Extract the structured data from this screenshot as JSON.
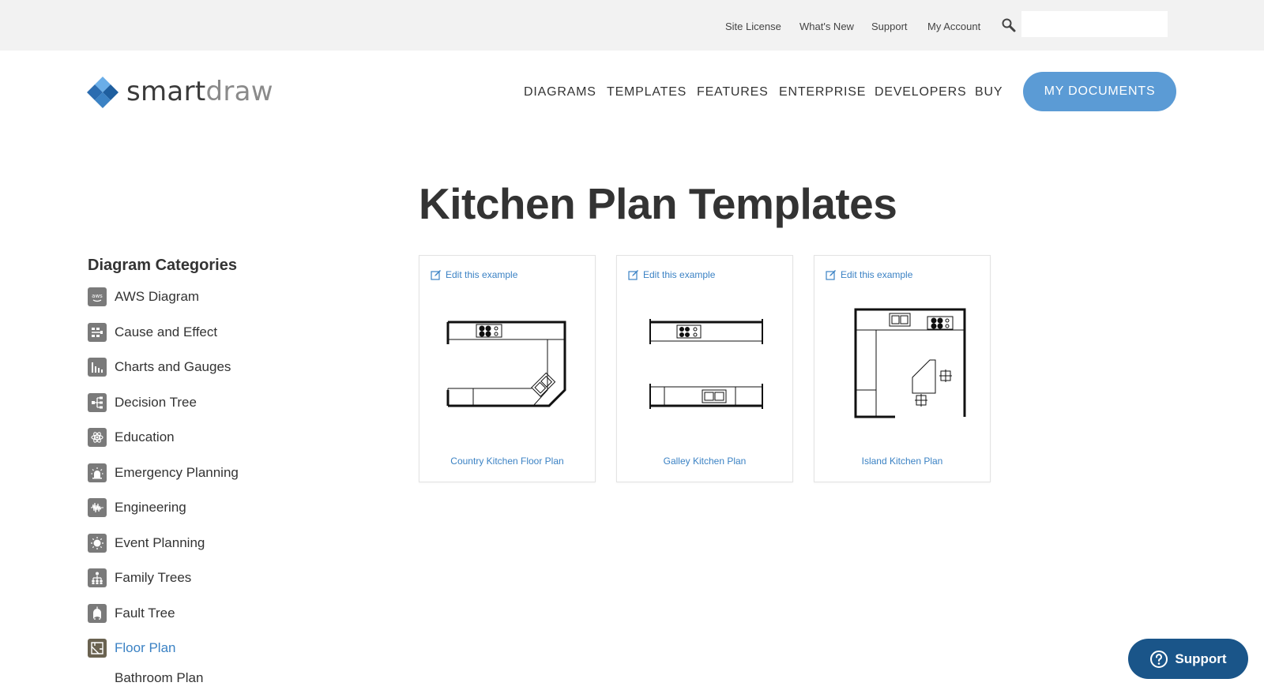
{
  "utility_nav": {
    "links": [
      "Site License",
      "What's New",
      "Support",
      "My Account"
    ],
    "search": {
      "placeholder": "",
      "value": ""
    }
  },
  "logo": {
    "part1": "smart",
    "part2": "draw"
  },
  "main_nav": {
    "items": [
      "DIAGRAMS",
      "TEMPLATES",
      "FEATURES",
      "ENTERPRISE",
      "DEVELOPERS",
      "BUY"
    ],
    "cta_label": "MY DOCUMENTS"
  },
  "page": {
    "title": "Kitchen Plan Templates"
  },
  "sidebar": {
    "heading": "Diagram Categories",
    "items": [
      {
        "label": "AWS Diagram",
        "icon": "aws-icon"
      },
      {
        "label": "Cause and Effect",
        "icon": "cause-effect-icon"
      },
      {
        "label": "Charts and Gauges",
        "icon": "bar-chart-icon"
      },
      {
        "label": "Decision Tree",
        "icon": "decision-tree-icon"
      },
      {
        "label": "Education",
        "icon": "atom-icon"
      },
      {
        "label": "Emergency Planning",
        "icon": "alarm-icon"
      },
      {
        "label": "Engineering",
        "icon": "waveform-icon"
      },
      {
        "label": "Event Planning",
        "icon": "sun-icon"
      },
      {
        "label": "Family Trees",
        "icon": "family-tree-icon"
      },
      {
        "label": "Fault Tree",
        "icon": "fault-tree-icon"
      },
      {
        "label": "Floor Plan",
        "icon": "floor-plan-icon",
        "active": true
      }
    ],
    "subitems": [
      "Bathroom Plan"
    ]
  },
  "cards": [
    {
      "edit_label": "Edit this example",
      "caption": "Country Kitchen Floor Plan",
      "thumbnail": "country-kitchen-plan"
    },
    {
      "edit_label": "Edit this example",
      "caption": "Galley Kitchen Plan",
      "thumbnail": "galley-kitchen-plan"
    },
    {
      "edit_label": "Edit this example",
      "caption": "Island Kitchen Plan",
      "thumbnail": "island-kitchen-plan"
    }
  ],
  "support_widget": {
    "label": "Support",
    "icon": "help-circle-icon"
  },
  "colors": {
    "accent": "#3b82c4",
    "cta": "#5b9bd5",
    "support": "#1a5589",
    "utility_bar": "#f2f2f2",
    "logo_blue": "#3b82c4"
  }
}
